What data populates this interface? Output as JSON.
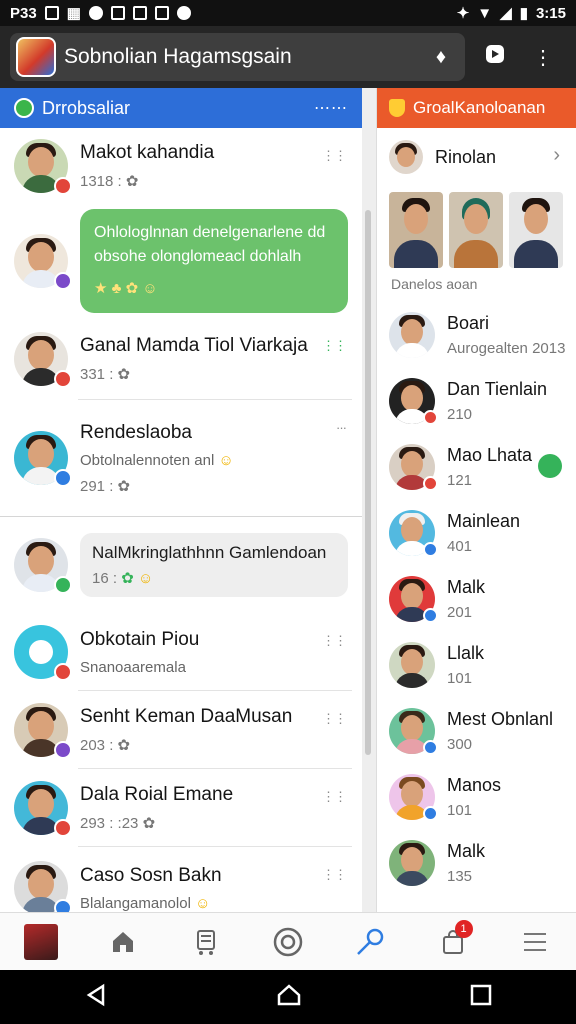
{
  "status_bar": {
    "left_text": "P33",
    "time": "3:15"
  },
  "app_bar": {
    "title": "Sobnolian Hagamsgsain"
  },
  "left_panel": {
    "title": "Drrobsaliar",
    "chats": [
      {
        "name": "Makot kahandia",
        "meta": "1318 :",
        "badge_color": "#e2453a"
      },
      {
        "message": "Ohlologlnnan denelgenarlene dd obsohe olonglomeacl dohlalh",
        "badge_color": "#7b4ac9"
      },
      {
        "name": "Ganal Mamda Tiol Viarkaja",
        "meta": "331 :",
        "badge_color": "#e2453a"
      },
      {
        "name": "Rendeslaoba",
        "sub": "Obtolnalennoten anl",
        "meta": "291 :",
        "badge_color": "#2f7de1"
      },
      {
        "message": "NalMkringlathhnn Gamlendoan",
        "meta": "16 :",
        "badge_color": "#35b35a"
      },
      {
        "name": "Obkotain Piou",
        "sub": "Snanoaaremala",
        "badge_color": "#e2453a"
      },
      {
        "name": "Senht Keman DaaMusan",
        "meta": "203 :",
        "badge_color": "#7b4ac9"
      },
      {
        "name": "Dala Roial Emane",
        "meta": "293 : :23",
        "badge_color": "#e2453a"
      },
      {
        "name": "Caso Sosn Bakn",
        "sub": "Blalangamanolol",
        "badge_color": "#2f7de1"
      }
    ]
  },
  "right_panel": {
    "title": "GroalKanoloanan",
    "top_user": "Rinolan",
    "photos_caption": "Danelos aoan",
    "users": [
      {
        "name": "Boari",
        "sub": "Aurogealten 2013"
      },
      {
        "name": "Dan Tienlain",
        "sub": "210"
      },
      {
        "name": "Mao Lhata",
        "sub": "121"
      },
      {
        "name": "Mainlean",
        "sub": "401"
      },
      {
        "name": "Malk",
        "sub": "201"
      },
      {
        "name": "Llalk",
        "sub": "101"
      },
      {
        "name": "Mest Obnlanl",
        "sub": "300"
      },
      {
        "name": "Manos",
        "sub": "101"
      },
      {
        "name": "Malk",
        "sub": "135"
      }
    ]
  },
  "bottom_nav": {
    "cart_badge": "1"
  },
  "colors": {
    "left_header": "#2d6ed8",
    "right_header": "#ea5a2a",
    "bubble_green": "#6cc26c"
  }
}
